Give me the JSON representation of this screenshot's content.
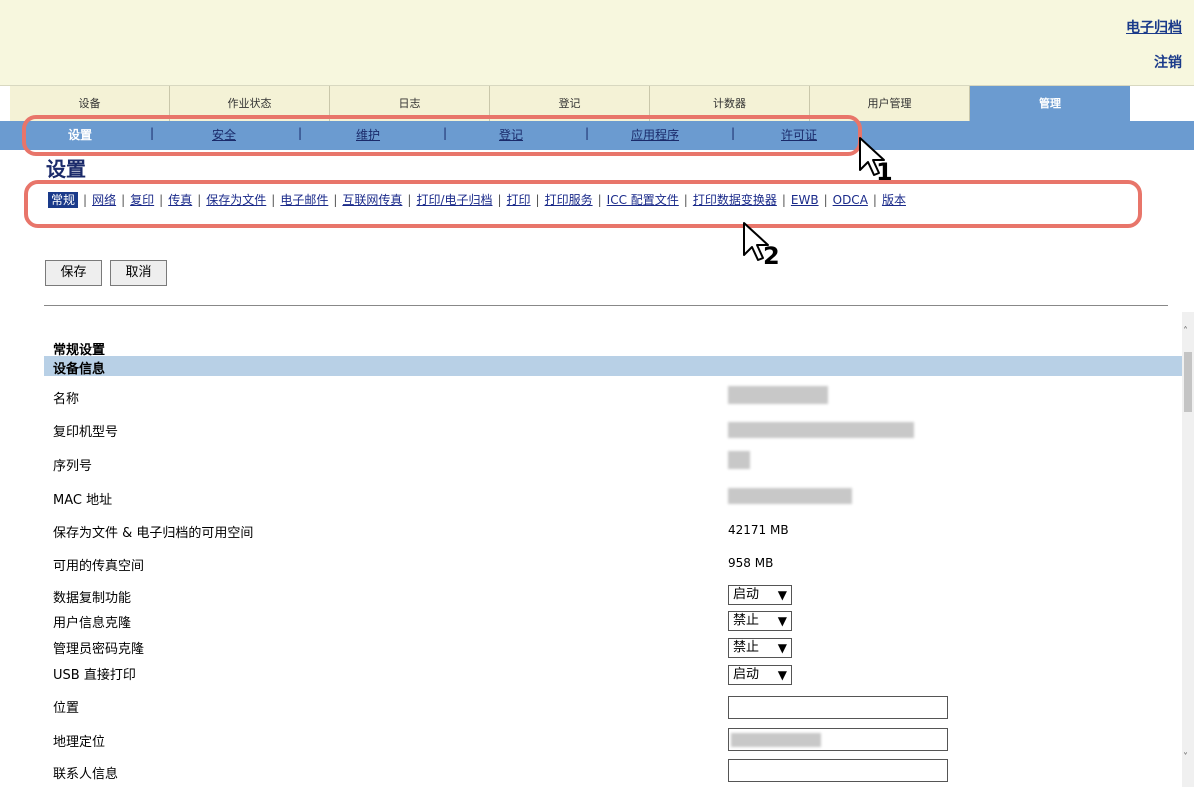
{
  "header": {
    "archive_link": "电子归档",
    "logout_link": "注销"
  },
  "tabs": [
    "设备",
    "作业状态",
    "日志",
    "登记",
    "计数器",
    "用户管理",
    "管理"
  ],
  "subnav": [
    "设置",
    "安全",
    "维护",
    "登记",
    "应用程序",
    "许可证"
  ],
  "page_title": "设置",
  "categories": [
    "常规",
    "网络",
    "复印",
    "传真",
    "保存为文件",
    "电子邮件",
    "互联网传真",
    "打印/电子归档",
    "打印",
    "打印服务",
    "ICC 配置文件",
    "打印数据变换器",
    "EWB",
    "ODCA",
    "版本"
  ],
  "buttons": {
    "save": "保存",
    "cancel": "取消"
  },
  "callouts": {
    "one": "1",
    "two": "2"
  },
  "section": {
    "title": "常规设置",
    "subtitle": "设备信息"
  },
  "rows": {
    "name": "名称",
    "model": "复印机型号",
    "serial": "序列号",
    "mac": "MAC 地址",
    "file_space": "保存为文件 & 电子归档的可用空间",
    "file_space_value": "42171 MB",
    "fax_space": "可用的传真空间",
    "fax_space_value": "958 MB",
    "data_copy": "数据复制功能",
    "data_copy_value": "启动",
    "user_clone": "用户信息克隆",
    "user_clone_value": "禁止",
    "admin_clone": "管理员密码克隆",
    "admin_clone_value": "禁止",
    "usb_print": "USB 直接打印",
    "usb_print_value": "启动",
    "location": "位置",
    "geo": "地理定位",
    "contact": "联系人信息"
  },
  "colors": {
    "tab_active": "#6b9bd0",
    "band": "#b8d0e6",
    "callout": "#e8756a",
    "link": "#1a2a8a"
  }
}
